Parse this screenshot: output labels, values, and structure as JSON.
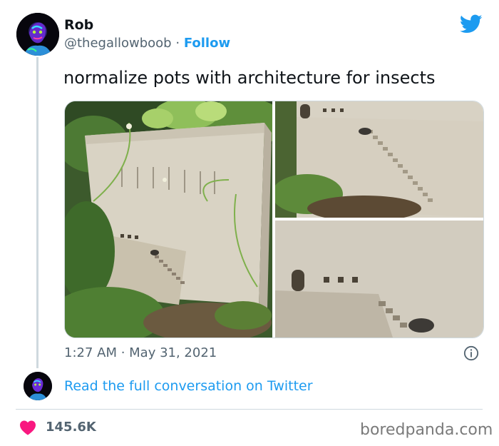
{
  "tweet": {
    "author_name": "Rob",
    "handle": "@thegallowboob",
    "separator": "·",
    "follow_label": "Follow",
    "text": "normalize pots with architecture for insects",
    "timestamp": "1:27 AM · May 31, 2021",
    "read_full_label": "Read the full conversation on Twitter",
    "likes": "145.6K"
  },
  "watermark": "boredpanda.com",
  "icons": {
    "brand": "twitter-bird-icon",
    "info": "info-icon",
    "like": "heart-icon"
  },
  "colors": {
    "twitter_blue": "#1d9bf0",
    "heart_pink": "#f91880",
    "text_primary": "#0f1419",
    "text_secondary": "#536471"
  }
}
